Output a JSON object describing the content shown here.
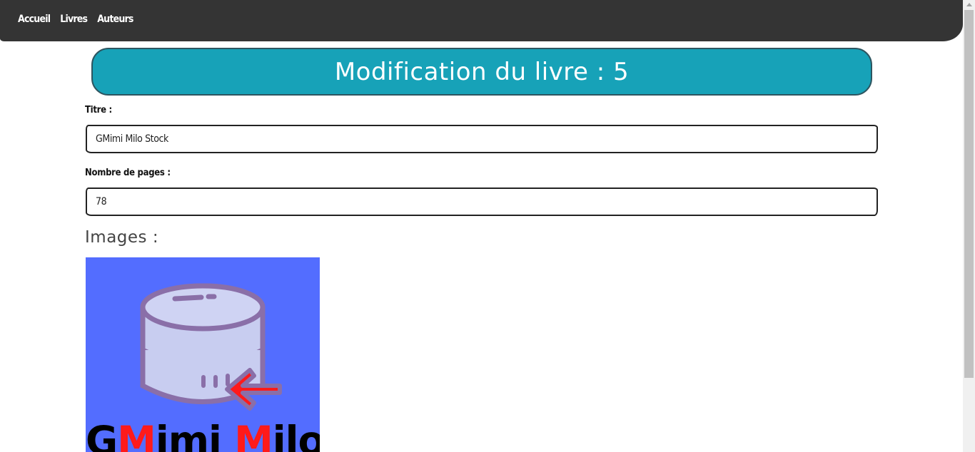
{
  "nav": {
    "links": [
      "Accueil",
      "Livres",
      "Auteurs"
    ]
  },
  "page": {
    "title": "Modification du livre : 5"
  },
  "form": {
    "title_label": "Titre :",
    "title_value": "GMimi Milo Stock",
    "pages_label": "Nombre de pages :",
    "pages_value": "78"
  },
  "images": {
    "heading": "Images :",
    "cover": {
      "logo_text_parts": [
        "G",
        "M",
        "imi ",
        "M",
        "ilo"
      ],
      "icon": "database-arrow-icon",
      "background_color": "#536dff"
    }
  },
  "colors": {
    "navbar": "#343434",
    "banner": "#17a2b8",
    "logo_accent": "#ff1a1a"
  }
}
